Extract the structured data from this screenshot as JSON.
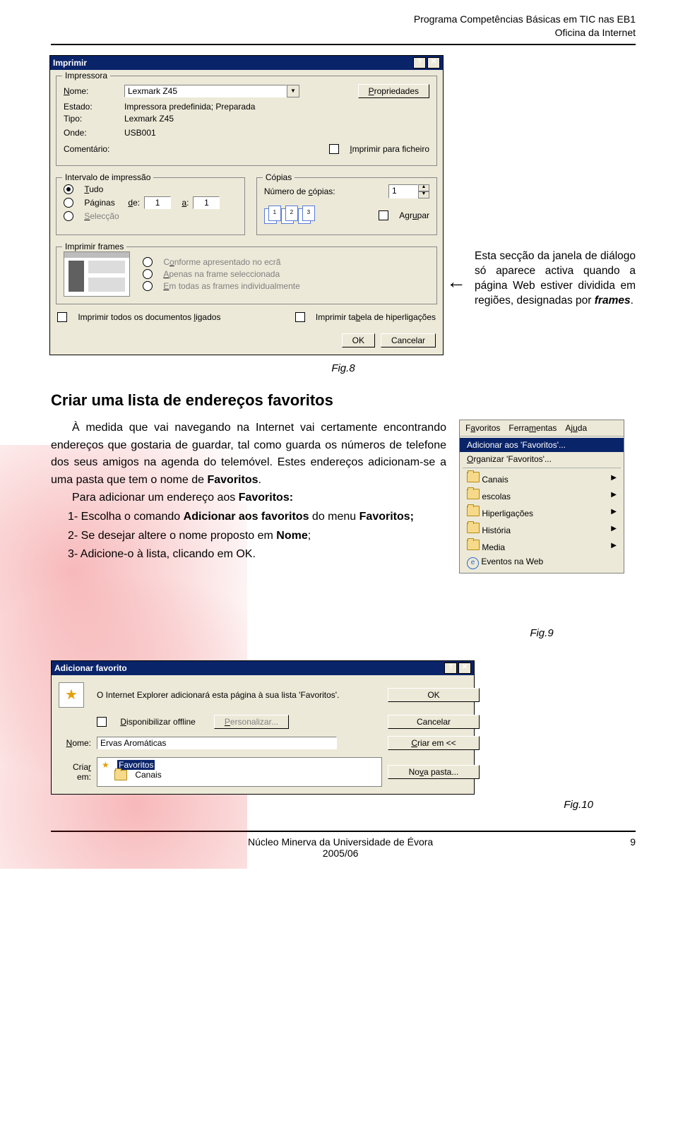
{
  "header": {
    "line1": "Programa Competências Básicas em TIC nas EB1",
    "line2": "Oficina da Internet"
  },
  "print_dlg": {
    "title": "Imprimir",
    "grp_printer": "Impressora",
    "lbl_name": "Nome:",
    "val_name": "Lexmark Z45",
    "btn_props": "Propriedades",
    "lbl_state": "Estado:",
    "val_state": "Impressora predefinida; Preparada",
    "lbl_type": "Tipo:",
    "val_type": "Lexmark Z45",
    "lbl_where": "Onde:",
    "val_where": "USB001",
    "lbl_comment": "Comentário:",
    "chk_tofile": "Imprimir para ficheiro",
    "grp_range": "Intervalo de impressão",
    "opt_all": "Tudo",
    "opt_pages": "Páginas",
    "lbl_from": "de:",
    "val_from": "1",
    "lbl_to": "a:",
    "val_to": "1",
    "opt_sel": "Selecção",
    "grp_copies": "Cópias",
    "lbl_numcopies": "Número de cópias:",
    "val_numcopies": "1",
    "chk_collate": "Agrupar",
    "collate_pages": [
      "1",
      "1",
      "2",
      "2",
      "3",
      "3"
    ],
    "grp_frames": "Imprimir frames",
    "opt_f1": "Conforme apresentado no ecrã",
    "opt_f2": "Apenas na frame seleccionada",
    "opt_f3": "Em todas as frames individualmente",
    "chk_linked": "Imprimir todos os documentos ligados",
    "chk_linktable": "Imprimir tabela de hiperligações",
    "btn_ok": "OK",
    "btn_cancel": "Cancelar"
  },
  "callout": "Esta secção da janela de diálogo só aparece activa quando a página Web estiver dividida em regiões, designadas por frames.",
  "fig8": "Fig.8",
  "section_title": "Criar uma lista de endereços favoritos",
  "body": {
    "p1": "À medida que vai navegando na Internet vai certamente encontrando endereços que gostaria de guardar, tal como guarda os números de telefone dos seus amigos na agenda do telemóvel. Estes endereços adicionam-se a uma pasta que tem o nome de ",
    "p1b": "Favoritos",
    "p1c": ".",
    "p2a": "Para adicionar um endereço aos ",
    "p2b": "Favoritos:",
    "li1a": "1- Escolha o comando ",
    "li1b": "Adicionar aos favoritos",
    "li1c": " do menu ",
    "li1d": "Favoritos;",
    "li2a": "2- Se desejar altere o nome proposto em ",
    "li2b": "Nome",
    "li2c": ";",
    "li3": "3- Adicione-o à lista, clicando em OK."
  },
  "fav_menu": {
    "bar": [
      "Favoritos",
      "Ferramentas",
      "Ajuda"
    ],
    "add": "Adicionar aos 'Favoritos'...",
    "org": "Organizar 'Favoritos'...",
    "items": [
      "Canais",
      "escolas",
      "Hiperligações",
      "História",
      "Media",
      "Eventos na Web"
    ]
  },
  "fig9": "Fig.9",
  "fav_dlg": {
    "title": "Adicionar favorito",
    "msg": "O Internet Explorer adicionará esta página à sua lista 'Favoritos'.",
    "btn_ok": "OK",
    "chk_offline": "Disponibilizar offline",
    "btn_personalize": "Personalizar...",
    "btn_cancel": "Cancelar",
    "lbl_name": "Nome:",
    "val_name": "Ervas Aromáticas",
    "btn_createin": "Criar em <<",
    "lbl_createin": "Criar em:",
    "tree_root": "Favoritos",
    "tree_child": "Canais",
    "btn_newfolder": "Nova pasta..."
  },
  "fig10": "Fig.10",
  "footer": {
    "center1": "Núcleo Minerva da Universidade de Évora",
    "center2": "2005/06",
    "page": "9"
  }
}
